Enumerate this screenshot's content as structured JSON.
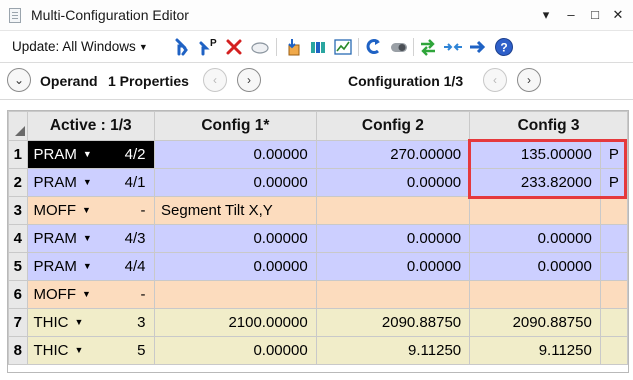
{
  "window": {
    "title": "Multi-Configuration Editor",
    "pin_icon": "pin-icon",
    "controls": [
      "dropdown-icon",
      "minimize-icon",
      "maximize-icon",
      "close-icon"
    ],
    "ctrl_glyphs": [
      "▾",
      "‒",
      "□",
      "✕"
    ]
  },
  "toolbar": {
    "update_label": "Update: All Windows",
    "icons": [
      "insert-operand-icon",
      "insert-config-icon",
      "delete-icon",
      "ellipse-icon",
      "import-icon",
      "show-icon",
      "graph-icon",
      "reload-icon",
      "toggle-icon",
      "swap-icon",
      "merge-icon",
      "forward-icon",
      "help-icon"
    ],
    "config_icon_label": "P"
  },
  "nav": {
    "operand_label": "Operand",
    "properties_label": "1 Properties",
    "config_label": "Configuration 1/3"
  },
  "grid": {
    "headers": {
      "active": "Active : 1/3",
      "configs": [
        "Config 1*",
        "Config 2",
        "Config 3"
      ]
    },
    "rows": [
      {
        "num": "1",
        "op": "PRAM",
        "param": "4/2",
        "type": "pram",
        "selected": true,
        "values": [
          "0.00000",
          "270.00000",
          "135.00000"
        ],
        "suffix": "P"
      },
      {
        "num": "2",
        "op": "PRAM",
        "param": "4/1",
        "type": "pram",
        "selected": false,
        "values": [
          "0.00000",
          "0.00000",
          "233.82000"
        ],
        "suffix": "P"
      },
      {
        "num": "3",
        "op": "MOFF",
        "param": "-",
        "type": "moff",
        "selected": false,
        "comment": "Segment Tilt X,Y",
        "values": [],
        "suffix": ""
      },
      {
        "num": "4",
        "op": "PRAM",
        "param": "4/3",
        "type": "pram",
        "selected": false,
        "values": [
          "0.00000",
          "0.00000",
          "0.00000"
        ],
        "suffix": ""
      },
      {
        "num": "5",
        "op": "PRAM",
        "param": "4/4",
        "type": "pram",
        "selected": false,
        "values": [
          "0.00000",
          "0.00000",
          "0.00000"
        ],
        "suffix": ""
      },
      {
        "num": "6",
        "op": "MOFF",
        "param": "-",
        "type": "moff",
        "selected": false,
        "values": [
          "",
          "",
          ""
        ],
        "suffix": ""
      },
      {
        "num": "7",
        "op": "THIC",
        "param": "3",
        "type": "thic",
        "selected": false,
        "values": [
          "2100.00000",
          "2090.88750",
          "2090.88750"
        ],
        "suffix": ""
      },
      {
        "num": "8",
        "op": "THIC",
        "param": "5",
        "type": "thic",
        "selected": false,
        "values": [
          "0.00000",
          "9.11250",
          "9.11250"
        ],
        "suffix": ""
      }
    ]
  },
  "colors": {
    "pram_row": "#cccfff",
    "moff_row": "#fcdcbe",
    "thic_row": "#f1edc9",
    "highlight": "#e5393d"
  }
}
